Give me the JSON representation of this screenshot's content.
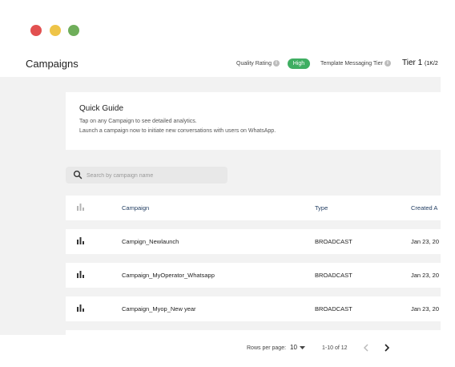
{
  "window": {
    "controls": [
      "close",
      "minimize",
      "maximize"
    ]
  },
  "header": {
    "title": "Campaigns",
    "quality_rating_label": "Quality Rating",
    "quality_rating_value": "High",
    "template_tier_label": "Template Messaging Tier",
    "tier_value": "Tier 1",
    "tier_sub": "(1K/2"
  },
  "guide": {
    "title": "Quick Guide",
    "line1": "Tap on any Campaign to see detailed analytics.",
    "line2": "Launch a campaign now to initiate new conversations with users on WhatsApp."
  },
  "search": {
    "placeholder": "Search by campaign name",
    "value": ""
  },
  "table": {
    "headers": {
      "campaign": "Campaign",
      "type": "Type",
      "created": "Created A"
    },
    "rows": [
      {
        "name": "Campign_Newlaunch",
        "type": "BROADCAST",
        "date": "Jan 23, 20"
      },
      {
        "name": "Campaign_MyOperator_Whatsapp",
        "type": "BROADCAST",
        "date": "Jan 23, 20"
      },
      {
        "name": "Campaign_Myop_New year",
        "type": "BROADCAST",
        "date": "Jan 23, 20"
      }
    ]
  },
  "pagination": {
    "rows_per_page_label": "Rows per page:",
    "rows_per_page_value": "10",
    "range": "1-10 of 12"
  },
  "colors": {
    "accent_green": "#3fae62",
    "header_text": "#1e3a5f",
    "background": "#f2f2f2"
  }
}
